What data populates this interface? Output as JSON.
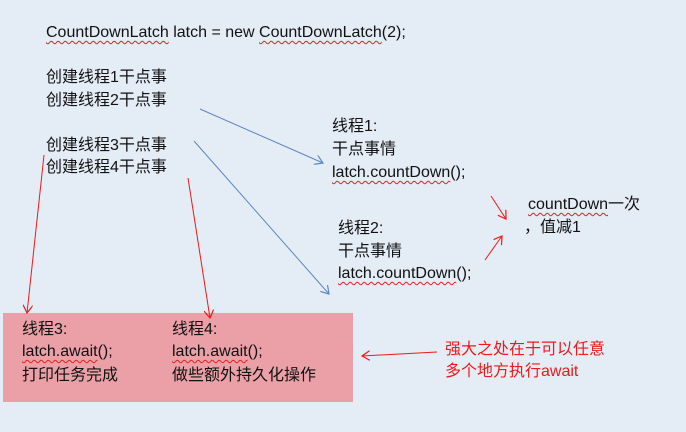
{
  "title_line": {
    "part1": "CountDownLatch",
    "part2": " latch = new ",
    "part3": "CountDownLatch",
    "part4": "(2);"
  },
  "create_lines": [
    "创建线程1干点事",
    "创建线程2干点事",
    "创建线程3干点事",
    "创建线程4干点事"
  ],
  "thread1": {
    "name": "线程1:",
    "work": "干点事情",
    "code": "latch.countDown",
    "code_tail": "();"
  },
  "thread2": {
    "name": "线程2:",
    "work": "干点事情",
    "code": "latch.countDown",
    "code_tail": "();"
  },
  "countdown_note": {
    "line1_code": "countDown",
    "line1_rest": "一次",
    "line2": "，值减1"
  },
  "thread3": {
    "name": "线程3:",
    "code": "latch.await",
    "code_tail": "();",
    "action": "打印任务完成"
  },
  "thread4": {
    "name": "线程4:",
    "code": "latch.await",
    "code_tail": "();",
    "action": "做些额外持久化操作"
  },
  "power_note": {
    "line1": "强大之处在于可以任意",
    "line2": "多个地方执行await"
  },
  "colors": {
    "background": "#e4ecf6",
    "box": "#eaa0a6",
    "blue_arrow": "#5b87c5",
    "red": "#f01818"
  }
}
